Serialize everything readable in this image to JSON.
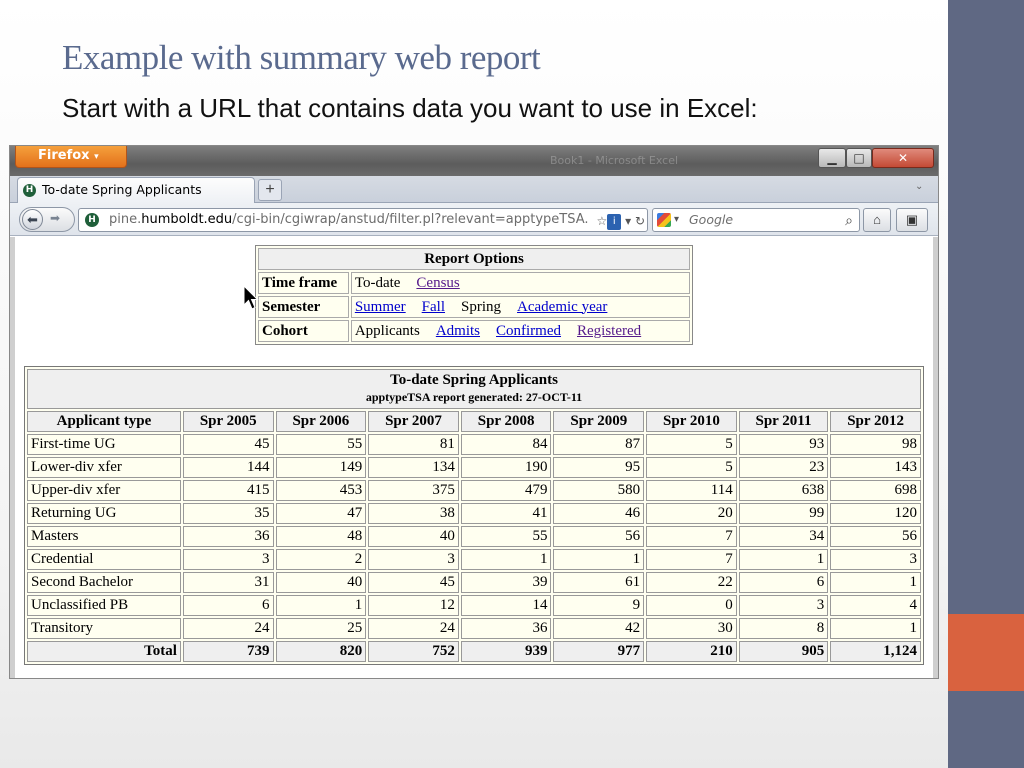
{
  "slide": {
    "title": "Example with summary web report",
    "subtitle": "Start with a URL that contains data you want to use in Excel:"
  },
  "browser": {
    "menu_label": "Firefox",
    "titlebar_faint": "Book1 - Microsoft Excel",
    "tab_title": "To-date Spring Applicants",
    "new_tab": "+",
    "url_prefix": "pine.",
    "url_domain": "humboldt.edu",
    "url_path": "/cgi-bin/cgiwrap/anstud/filter.pl?relevant=apptypeTSA.",
    "search_placeholder": "Google",
    "site_icon": "H"
  },
  "report_options": {
    "title": "Report Options",
    "rows": [
      {
        "label": "Time frame",
        "items": [
          {
            "text": "To-date",
            "link": false
          },
          {
            "text": "Census",
            "link": true,
            "visited": true
          }
        ]
      },
      {
        "label": "Semester",
        "items": [
          {
            "text": "Summer",
            "link": true
          },
          {
            "text": "Fall",
            "link": true
          },
          {
            "text": "Spring",
            "link": false
          },
          {
            "text": "Academic year",
            "link": true
          }
        ]
      },
      {
        "label": "Cohort",
        "items": [
          {
            "text": "Applicants",
            "link": false
          },
          {
            "text": "Admits",
            "link": true
          },
          {
            "text": "Confirmed",
            "link": true
          },
          {
            "text": "Registered",
            "link": true,
            "visited": true
          }
        ]
      }
    ]
  },
  "report": {
    "title": "To-date Spring Applicants",
    "subtitle": "apptypeTSA report generated: 27-OCT-11",
    "columns": [
      "Applicant type",
      "Spr 2005",
      "Spr 2006",
      "Spr 2007",
      "Spr 2008",
      "Spr 2009",
      "Spr 2010",
      "Spr 2011",
      "Spr 2012"
    ],
    "rows": [
      {
        "type": "First-time UG",
        "values": [
          "45",
          "55",
          "81",
          "84",
          "87",
          "5",
          "93",
          "98"
        ]
      },
      {
        "type": "Lower-div xfer",
        "values": [
          "144",
          "149",
          "134",
          "190",
          "95",
          "5",
          "23",
          "143"
        ]
      },
      {
        "type": "Upper-div xfer",
        "values": [
          "415",
          "453",
          "375",
          "479",
          "580",
          "114",
          "638",
          "698"
        ]
      },
      {
        "type": "Returning UG",
        "values": [
          "35",
          "47",
          "38",
          "41",
          "46",
          "20",
          "99",
          "120"
        ]
      },
      {
        "type": "Masters",
        "values": [
          "36",
          "48",
          "40",
          "55",
          "56",
          "7",
          "34",
          "56"
        ]
      },
      {
        "type": "Credential",
        "values": [
          "3",
          "2",
          "3",
          "1",
          "1",
          "7",
          "1",
          "3"
        ]
      },
      {
        "type": "Second Bachelor",
        "values": [
          "31",
          "40",
          "45",
          "39",
          "61",
          "22",
          "6",
          "1"
        ]
      },
      {
        "type": "Unclassified PB",
        "values": [
          "6",
          "1",
          "12",
          "14",
          "9",
          "0",
          "3",
          "4"
        ]
      },
      {
        "type": "Transitory",
        "values": [
          "24",
          "25",
          "24",
          "36",
          "42",
          "30",
          "8",
          "1"
        ]
      }
    ],
    "total": {
      "type": "Total",
      "values": [
        "739",
        "820",
        "752",
        "939",
        "977",
        "210",
        "905",
        "1,124"
      ]
    }
  },
  "colors": {
    "side_bar": "#5f6883",
    "side_accent": "#d9623f",
    "title": "#5a6a8e"
  }
}
